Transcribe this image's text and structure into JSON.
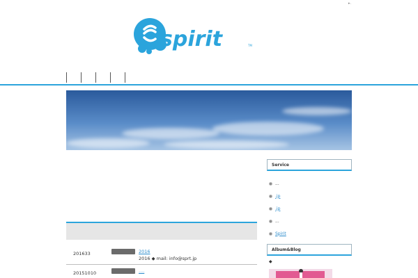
{
  "top_mark": "▸.",
  "logo": {
    "text": "spirit",
    "tm": "TM",
    "color": "#2ba4dc"
  },
  "nav": {
    "items": [
      "",
      "",
      "",
      "",
      ""
    ]
  },
  "sidebar": {
    "service_title": "Service",
    "items": [
      {
        "text": "...",
        "link": false
      },
      {
        "text": ".jp",
        "link": true
      },
      {
        "text": ".jp",
        "link": true
      },
      {
        "text": "...",
        "link": false
      },
      {
        "text": "Spirit",
        "link": true
      }
    ],
    "album_title": "Album&Blog",
    "album_bullet": "◆"
  },
  "news": {
    "rows": [
      {
        "date": "201633",
        "title": "2016",
        "desc": "2016 ◆ mail: info@sprt.jp"
      },
      {
        "date": "20151010",
        "title": "....",
        "desc": ""
      }
    ]
  },
  "colors": {
    "accent": "#2ba4dc",
    "sky_top": "#2d5d9e",
    "sky_bottom": "#8fb4dc"
  }
}
